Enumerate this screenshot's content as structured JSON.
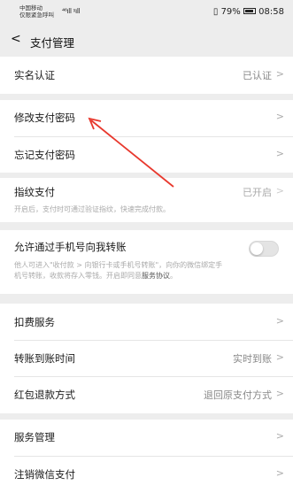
{
  "status_bar": {
    "carrier_line1": "中国移动",
    "carrier_line2": "仅限紧急呼叫",
    "signal": "⁴⁶ıll ᵡıll",
    "battery_percent": "79%",
    "time": "08:58"
  },
  "header": {
    "back_icon": "chevron-left-icon",
    "title": "支付管理"
  },
  "rows": {
    "real_name": {
      "label": "实名认证",
      "value": "已认证"
    },
    "change_pwd": {
      "label": "修改支付密码"
    },
    "forgot_pwd": {
      "label": "忘记支付密码"
    },
    "fingerprint": {
      "label": "指纹支付",
      "value": "已开启",
      "note": "开启后，支付时可通过验证指纹，快速完成付款。"
    },
    "phone_transfer": {
      "label": "允许通过手机号向我转账",
      "note_line1": "他人可进入\"收付款 > 向银行卡或手机号转账\"，向你的微信绑定手",
      "note_line2_prefix": "机号转账，收款将存入零钱。开启即同意",
      "note_link": "服务协议",
      "note_suffix": "。",
      "enabled": false
    },
    "deduction": {
      "label": "扣费服务"
    },
    "transfer_time": {
      "label": "转账到账时间",
      "value": "实时到账"
    },
    "refund": {
      "label": "红包退款方式",
      "value": "退回原支付方式"
    },
    "service_mgmt": {
      "label": "服务管理"
    },
    "cancel_pay": {
      "label": "注销微信支付"
    }
  },
  "annotation": {
    "color": "#e8382d"
  }
}
